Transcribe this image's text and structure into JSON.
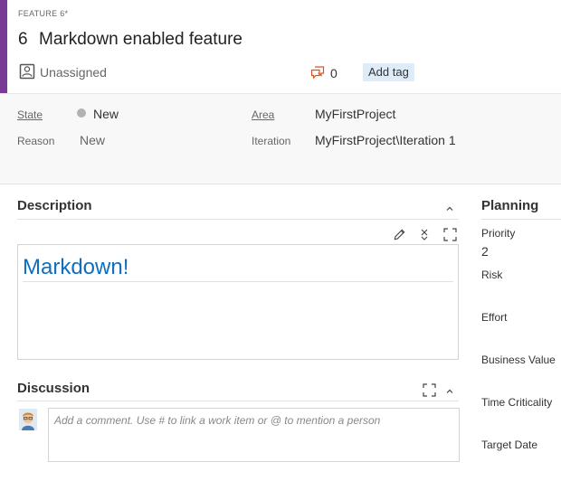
{
  "header": {
    "type_label": "FEATURE 6*",
    "id": "6",
    "title": "Markdown enabled feature",
    "assigned_to": "Unassigned",
    "comment_count": "0",
    "add_tag_label": "Add tag",
    "accent_color": "#773b93"
  },
  "fields": {
    "state_label": "State",
    "state_value": "New",
    "reason_label": "Reason",
    "reason_value": "New",
    "area_label": "Area",
    "area_value": "MyFirstProject",
    "iteration_label": "Iteration",
    "iteration_value": "MyFirstProject\\Iteration 1"
  },
  "description": {
    "title": "Description",
    "content_heading": "Markdown!",
    "heading_color": "#106ebe"
  },
  "discussion": {
    "title": "Discussion",
    "placeholder": "Add a comment. Use # to link a work item or @ to mention a person"
  },
  "planning": {
    "title": "Planning",
    "priority_label": "Priority",
    "priority_value": "2",
    "risk_label": "Risk",
    "effort_label": "Effort",
    "business_value_label": "Business Value",
    "time_criticality_label": "Time Criticality",
    "target_date_label": "Target Date"
  },
  "icons": [
    "person-icon",
    "comment-icon",
    "pencil-icon",
    "close-icon",
    "fullscreen-icon",
    "chevron-up-icon",
    "avatar"
  ]
}
